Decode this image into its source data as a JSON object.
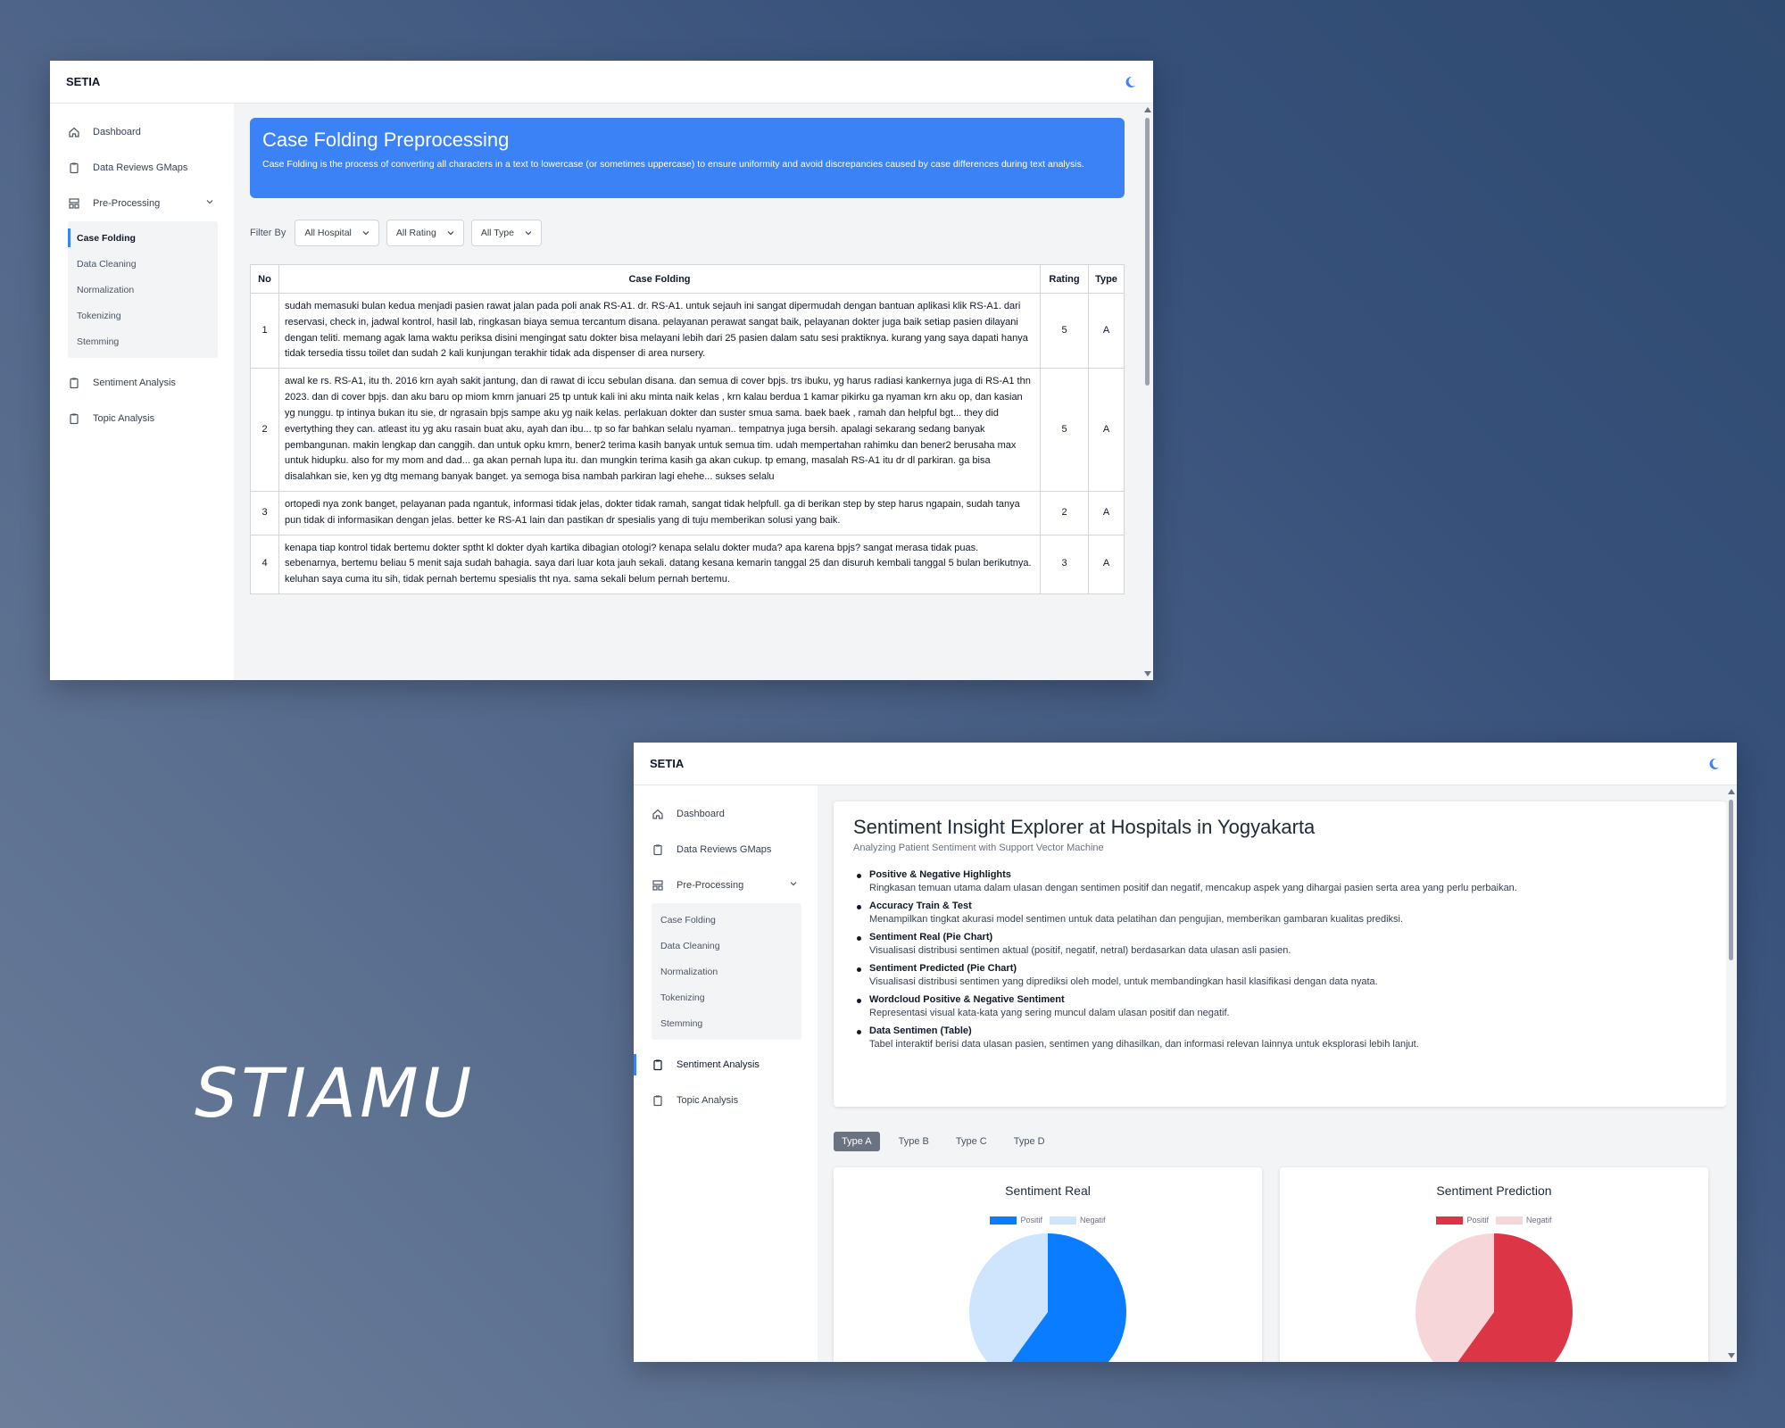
{
  "brand_text": "STIAMU",
  "app": {
    "name": "SETIA"
  },
  "sidebar": {
    "dashboard": "Dashboard",
    "data_reviews": "Data Reviews GMaps",
    "preprocessing": "Pre-Processing",
    "sub": [
      "Case Folding",
      "Data Cleaning",
      "Normalization",
      "Tokenizing",
      "Stemming"
    ],
    "sentiment": "Sentiment Analysis",
    "topic": "Topic Analysis"
  },
  "casefolding": {
    "title": "Case Folding Preprocessing",
    "desc": "Case Folding is the process of converting all characters in a text to lowercase (or sometimes uppercase) to ensure uniformity and avoid discrepancies caused by case differences during text analysis.",
    "filter_label": "Filter By",
    "filters": [
      "All Hospital",
      "All Rating",
      "All Type"
    ],
    "columns": [
      "No",
      "Case Folding",
      "Rating",
      "Type"
    ],
    "rows": [
      {
        "no": "1",
        "text": "sudah memasuki bulan kedua menjadi pasien rawat jalan pada poli anak RS-A1. dr. RS-A1. untuk sejauh ini sangat dipermudah dengan bantuan aplikasi klik RS-A1. dari reservasi, check in, jadwal kontrol, hasil lab, ringkasan biaya semua tercantum disana. pelayanan perawat sangat baik, pelayanan dokter juga baik setiap pasien dilayani dengan teliti. memang agak lama waktu periksa disini mengingat satu dokter bisa melayani lebih dari 25 pasien dalam satu sesi praktiknya. kurang yang saya dapati hanya tidak tersedia tissu toilet dan sudah 2 kali kunjungan terakhir tidak ada dispenser di area nursery.",
        "rating": "5",
        "type": "A"
      },
      {
        "no": "2",
        "text": "awal ke rs. RS-A1, itu th. 2016 krn ayah sakit jantung, dan di rawat di iccu sebulan disana. dan semua di cover bpjs. trs ibuku, yg harus radiasi kankernya juga di RS-A1 thn 2023. dan di cover bpjs. dan aku baru op miom kmrn januari 25 tp untuk kali ini aku minta naik kelas , krn kalau berdua 1 kamar pikirku ga nyaman krn aku op, dan kasian yg nunggu. tp intinya bukan itu sie, dr ngrasain bpjs sampe aku yg naik kelas. perlakuan dokter dan suster smua sama. baek baek , ramah dan helpful bgt... they did evertything they can. atleast itu yg aku rasain buat aku, ayah dan ibu... tp so far bahkan selalu nyaman.. tempatnya juga bersih. apalagi sekarang sedang banyak pembangunan. makin lengkap dan canggih. dan untuk opku kmrn, bener2 terima kasih banyak untuk semua tim. udah mempertahan rahimku dan bener2 berusaha max untuk hidupku. also for my mom and dad... ga akan pernah lupa itu. dan mungkin terima kasih ga akan cukup. tp emang, masalah RS-A1 itu dr dl parkiran. ga bisa disalahkan sie, ken yg dtg memang banyak banget. ya semoga bisa nambah parkiran lagi ehehe... sukses selalu",
        "rating": "5",
        "type": "A"
      },
      {
        "no": "3",
        "text": "ortopedi nya zonk banget, pelayanan pada ngantuk, informasi tidak jelas, dokter tidak ramah, sangat tidak helpfull. ga di berikan step by step harus ngapain, sudah tanya pun tidak di informasikan dengan jelas. better ke RS-A1 lain dan pastikan dr spesialis yang di tuju memberikan solusi yang baik.",
        "rating": "2",
        "type": "A"
      },
      {
        "no": "4",
        "text": "kenapa tiap kontrol tidak bertemu dokter sptht kl dokter dyah kartika dibagian otologi? kenapa selalu dokter muda? apa karena bpjs? sangat merasa tidak puas. sebenarnya, bertemu beliau 5 menit saja sudah bahagia. saya dari luar kota jauh sekali. datang kesana kemarin tanggal 25 dan disuruh kembali tanggal 5 bulan berikutnya. keluhan saya cuma itu sih, tidak pernah bertemu spesialis tht nya. sama sekali belum pernah bertemu.",
        "rating": "3",
        "type": "A"
      }
    ]
  },
  "sentiment": {
    "title": "Sentiment Insight Explorer at Hospitals in Yogyakarta",
    "subtitle": "Analyzing Patient Sentiment with Support Vector Machine",
    "points": [
      {
        "title": "Positive & Negative Highlights",
        "desc": "Ringkasan temuan utama dalam ulasan dengan sentimen positif dan negatif, mencakup aspek yang dihargai pasien serta area yang perlu perbaikan."
      },
      {
        "title": "Accuracy Train & Test",
        "desc": "Menampilkan tingkat akurasi model sentimen untuk data pelatihan dan pengujian, memberikan gambaran kualitas prediksi."
      },
      {
        "title": "Sentiment Real (Pie Chart)",
        "desc": "Visualisasi distribusi sentimen aktual (positif, negatif, netral) berdasarkan data ulasan asli pasien."
      },
      {
        "title": "Sentiment Predicted (Pie Chart)",
        "desc": "Visualisasi distribusi sentimen yang diprediksi oleh model, untuk membandingkan hasil klasifikasi dengan data nyata."
      },
      {
        "title": "Wordcloud Positive & Negative Sentiment",
        "desc": "Representasi visual kata-kata yang sering muncul dalam ulasan positif dan negatif."
      },
      {
        "title": "Data Sentimen (Table)",
        "desc": "Tabel interaktif berisi data ulasan pasien, sentimen yang dihasilkan, dan informasi relevan lainnya untuk eksplorasi lebih lanjut."
      }
    ],
    "tabs": [
      "Type A",
      "Type B",
      "Type C",
      "Type D"
    ]
  },
  "chart_data": [
    {
      "type": "pie",
      "title": "Sentiment Real",
      "labels": [
        "Positif",
        "Negatif"
      ],
      "values": [
        60,
        40
      ],
      "colors": [
        "#0a7cff",
        "#cfe4fd"
      ]
    },
    {
      "type": "pie",
      "title": "Sentiment Prediction",
      "labels": [
        "Positif",
        "Negatif"
      ],
      "values": [
        60,
        40
      ],
      "colors": [
        "#dc3545",
        "#f7d6d9"
      ]
    }
  ]
}
